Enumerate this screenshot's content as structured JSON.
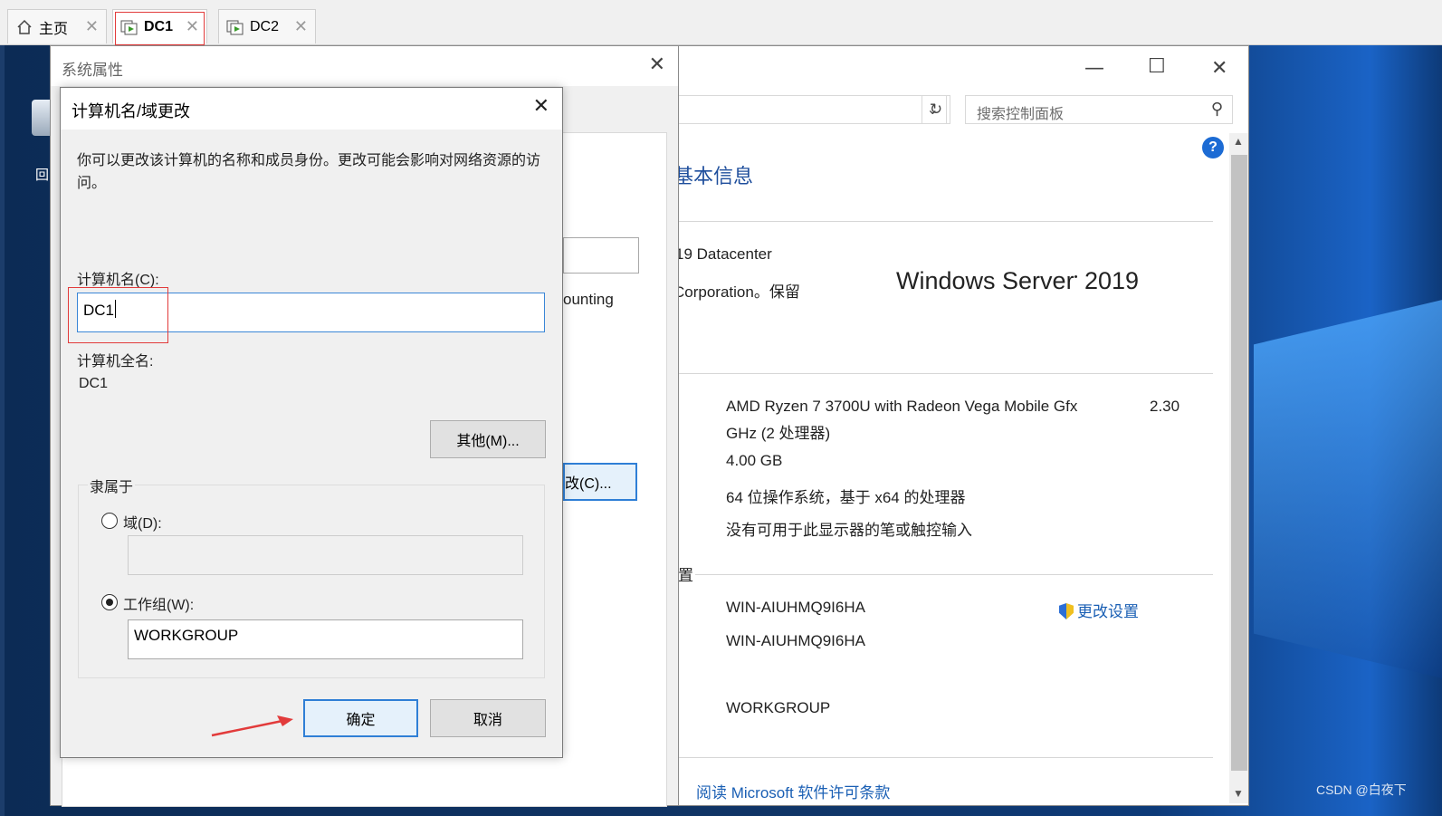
{
  "tabs": [
    {
      "label": "主页"
    },
    {
      "label": "DC1"
    },
    {
      "label": "DC2"
    }
  ],
  "desktop": {
    "recycle_label": "回收"
  },
  "control_panel": {
    "search_placeholder": "搜索控制面板",
    "heading": "基本信息",
    "edition": "19 Datacenter",
    "copyright": "Corporation。保留",
    "logo_text": "Windows Server",
    "logo_year": "2019",
    "processor_line1": "AMD Ryzen 7 3700U with Radeon Vega Mobile Gfx",
    "processor_speed": "2.30",
    "processor_line2": "GHz  (2 处理器)",
    "memory": "4.00 GB",
    "system_type": "64 位操作系统，基于 x64 的处理器",
    "pen_touch": "没有可用于此显示器的笔或触控输入",
    "section_settings": "置",
    "computer_name": "WIN-AIUHMQ9I6HA",
    "full_name": "WIN-AIUHMQ9I6HA",
    "workgroup": "WORKGROUP",
    "change_settings": "更改设置",
    "license_link": "阅读 Microsoft 软件许可条款"
  },
  "system_properties": {
    "title": "系统属性",
    "partial_text": "ounting",
    "change_button": "改(C)..."
  },
  "dialog": {
    "title": "计算机名/域更改",
    "description": "你可以更改该计算机的名称和成员身份。更改可能会影响对网络资源的访问。",
    "computer_name_label": "计算机名(C):",
    "computer_name_value": "DC1",
    "full_name_label": "计算机全名:",
    "full_name_value": "DC1",
    "more_button": "其他(M)...",
    "member_of_label": "隶属于",
    "domain_label": "域(D):",
    "domain_value": "",
    "workgroup_label": "工作组(W):",
    "workgroup_value": "WORKGROUP",
    "ok_button": "确定",
    "cancel_button": "取消"
  },
  "watermark": "CSDN @白夜下",
  "colors": {
    "accent": "#2f7fd6",
    "link": "#1a5fb4",
    "annotation_red": "#e23b3b"
  }
}
